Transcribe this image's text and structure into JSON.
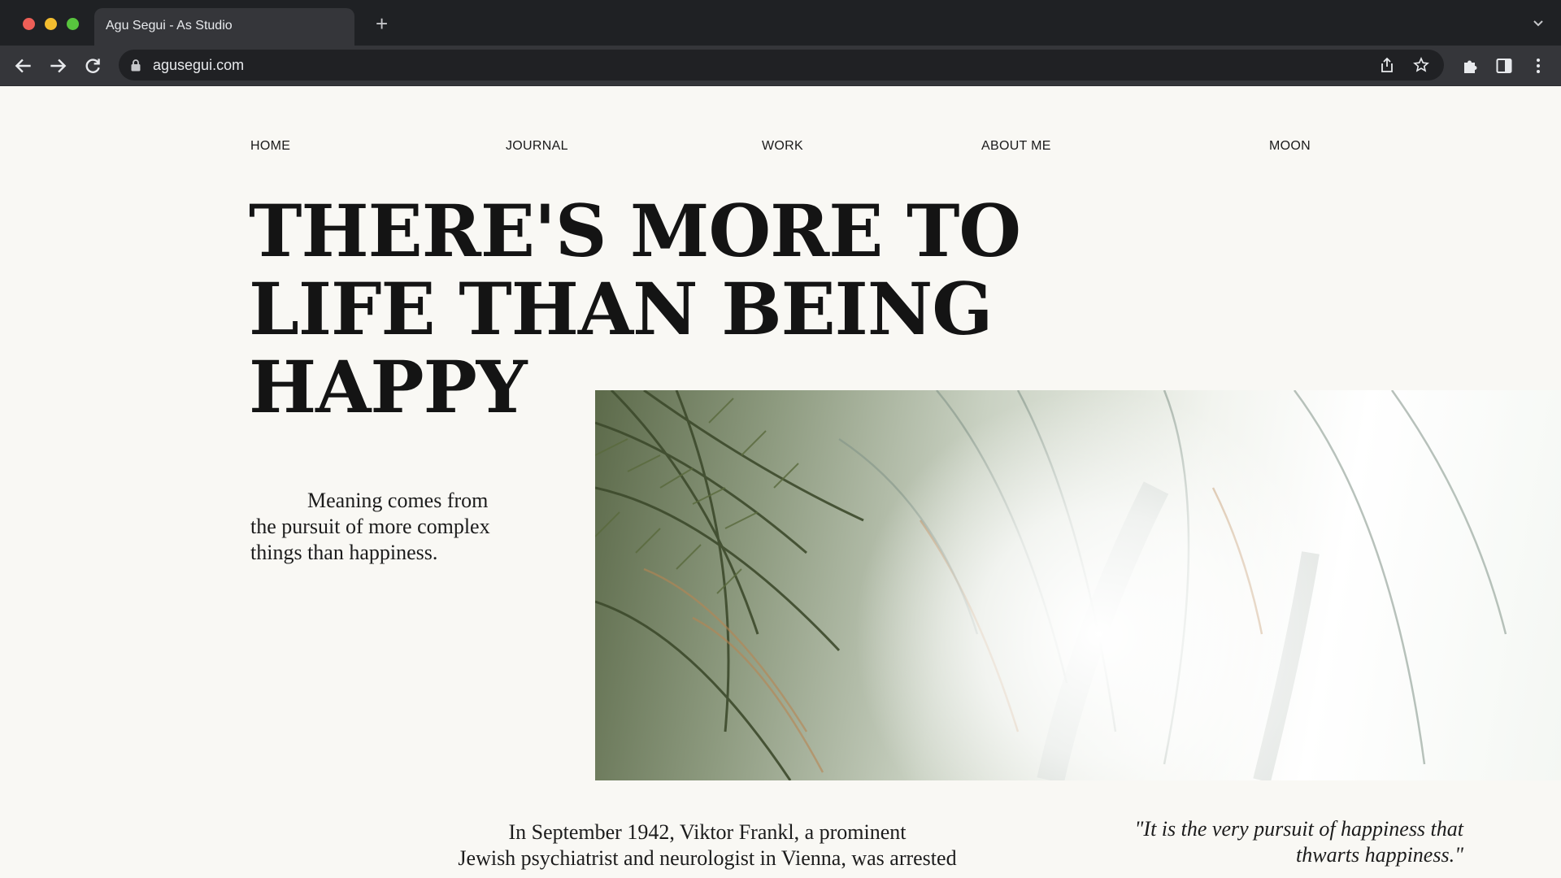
{
  "browser": {
    "tab_title": "Agu Segui - As Studio",
    "new_tab": "+",
    "url": "agusegui.com"
  },
  "nav": {
    "home": "HOME",
    "journal": "JOURNAL",
    "work": "WORK",
    "about": "ABOUT ME",
    "moon": "MOON"
  },
  "hero": {
    "headline": [
      "THERE'S MORE TO",
      "LIFE THAN BEING",
      "HAPPY"
    ],
    "subtext": "Meaning comes from the pursuit of more complex things than happiness."
  },
  "article": {
    "intro_line1": "In September 1942, Viktor Frankl, a prominent",
    "intro_line2": "Jewish psychiatrist and neurologist in Vienna, was arrested",
    "quote": "\"It is the very pursuit of happiness that thwarts happiness.\""
  },
  "colors": {
    "page_background": "#f9f8f4",
    "chrome_dark": "#1f2124",
    "text": "#141414"
  }
}
